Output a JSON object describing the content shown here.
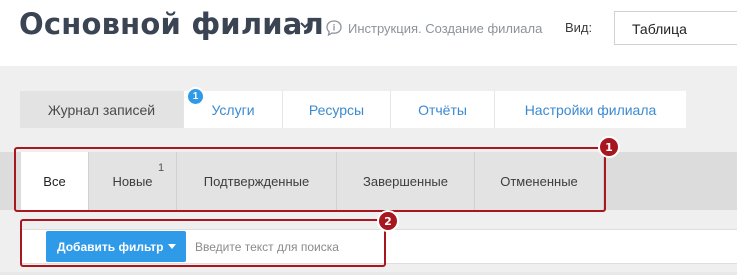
{
  "header": {
    "title": "Основной филиал",
    "help_link": "Инструкция. Создание филиала",
    "view_label": "Вид:",
    "view_value": "Таблица"
  },
  "main_tabs": [
    {
      "label": "Журнал записей",
      "active": true,
      "badge": "1"
    },
    {
      "label": "Услуги"
    },
    {
      "label": "Ресурсы"
    },
    {
      "label": "Отчёты"
    },
    {
      "label": "Настройки филиала"
    }
  ],
  "status_tabs": [
    {
      "label": "Все",
      "active": true
    },
    {
      "label": "Новые",
      "count": "1"
    },
    {
      "label": "Подтвержденные"
    },
    {
      "label": "Завершенные"
    },
    {
      "label": "Отмененные"
    }
  ],
  "filter": {
    "add_filter_label": "Добавить фильтр",
    "search_placeholder": "Введите текст для поиска"
  },
  "callouts": [
    "1",
    "2"
  ],
  "colors": {
    "accent": "#2f9be8",
    "title": "#3a4452",
    "callout": "#a8161f",
    "tab_link": "#3a8ad2"
  }
}
